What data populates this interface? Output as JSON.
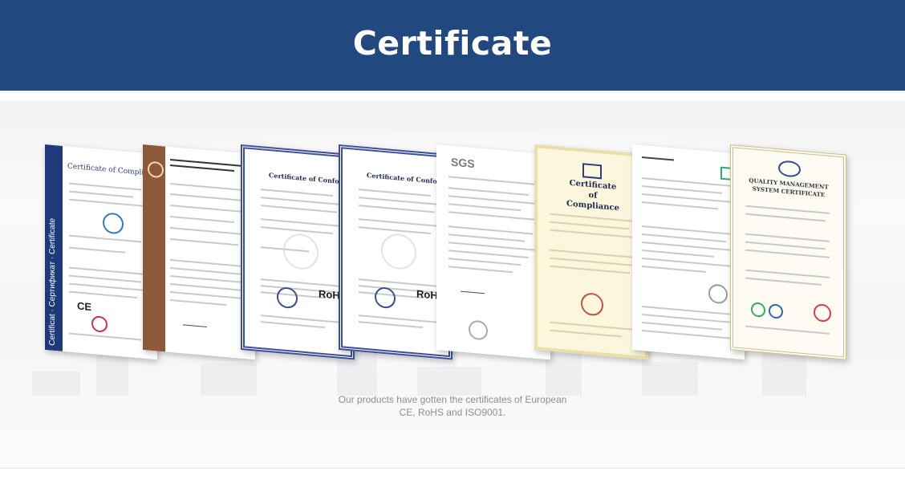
{
  "header": {
    "title": "Certificate"
  },
  "certificates": [
    {
      "kind": "ce-compliance",
      "heading": "Certificate of Compliance",
      "side_text": "Certificat · Сертификат · Certificate"
    },
    {
      "kind": "brown-attestation",
      "heading": ""
    },
    {
      "kind": "conformity-blue",
      "heading": "Certificate of Conformity",
      "mark": "RoHS"
    },
    {
      "kind": "conformity-blue",
      "heading": "Certificate of Conformity",
      "mark": "RoHS"
    },
    {
      "kind": "sgs",
      "heading": "SGS"
    },
    {
      "kind": "compliance-gold",
      "heading": "Certificate of Compliance"
    },
    {
      "kind": "plain",
      "heading": ""
    },
    {
      "kind": "quality",
      "heading": "QUALITY MANAGEMENT SYSTEM CERTIFICATE"
    }
  ],
  "caption": {
    "line1": "Our products have gotten the certificates of European",
    "line2": "CE, RoHS and ISO9001."
  },
  "colors": {
    "header_bg": "#22497f",
    "header_text": "#ffffff",
    "caption_text": "#8e8e8e"
  }
}
